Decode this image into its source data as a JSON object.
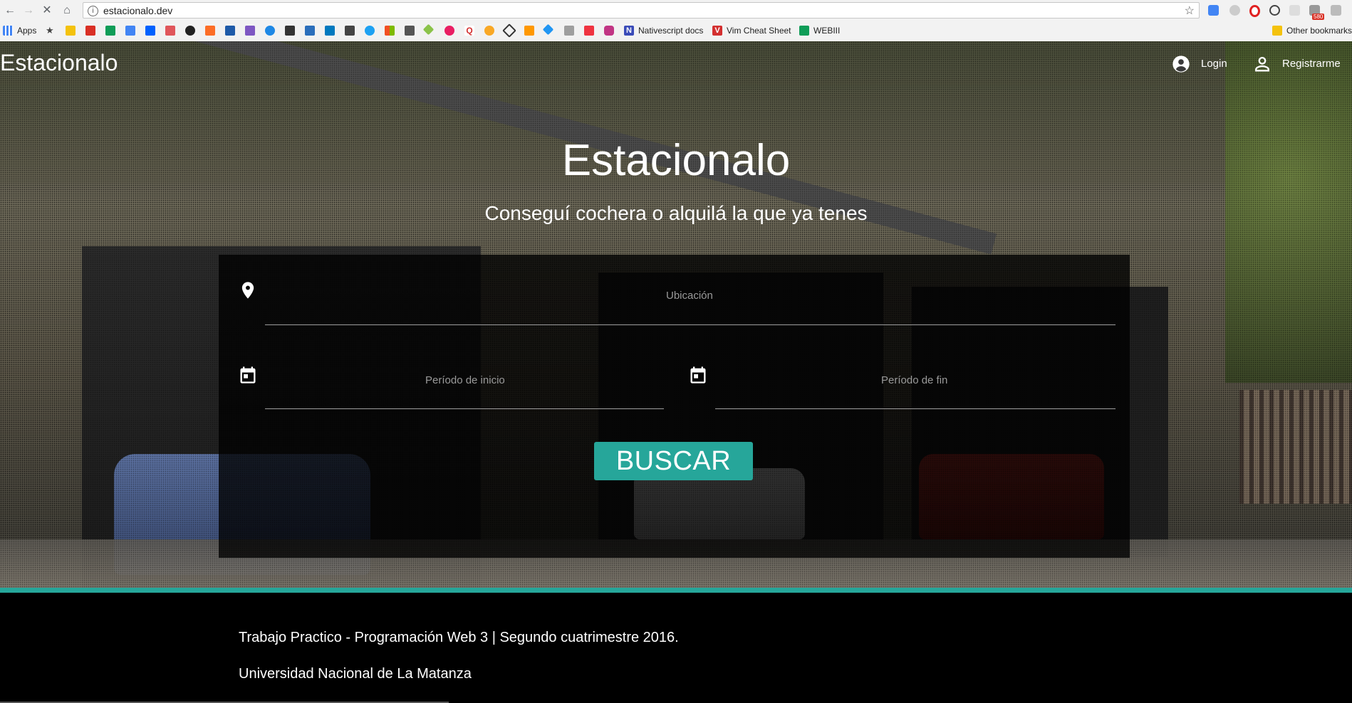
{
  "browser": {
    "url": "estacionalo.dev",
    "bookmarks": {
      "apps_label": "Apps",
      "nativescript_label": "Nativescript docs",
      "vim_label": "Vim Cheat Sheet",
      "webiii_label": "WEBIII",
      "other_label": "Other bookmarks"
    },
    "ext_badge": "580"
  },
  "nav": {
    "brand": "Estacionalo",
    "login": "Login",
    "register": "Registrarme"
  },
  "hero": {
    "title": "Estacionalo",
    "subtitle": "Conseguí cochera o alquilá la que ya tenes"
  },
  "search": {
    "location_label": "Ubicación",
    "start_label": "Período de inicio",
    "end_label": "Período de fin",
    "button": "BUSCAR"
  },
  "footer": {
    "line1": "Trabajo Practico - Programación Web 3 | Segundo cuatrimestre 2016.",
    "line2": "Universidad Nacional de La Matanza"
  },
  "colors": {
    "accent": "#26a69a",
    "panel": "rgba(0,0,0,0.78)"
  },
  "icons": [
    "back-icon",
    "forward-icon",
    "stop-icon",
    "home-icon",
    "info-icon",
    "star-icon",
    "location-pin-icon",
    "calendar-icon",
    "account-circle-icon",
    "person-icon"
  ]
}
